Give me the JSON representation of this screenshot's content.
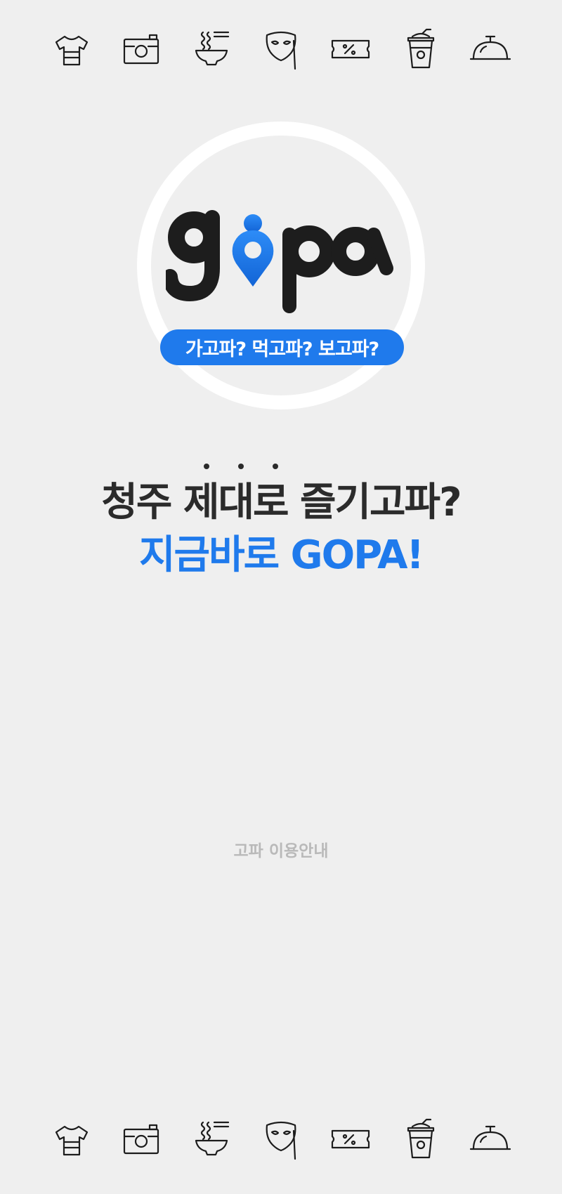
{
  "logo": {
    "wordmark": "gopa",
    "tagline": "가고파? 먹고파? 보고파?",
    "brand_color": "#1f7aec"
  },
  "headline": {
    "line1": "청주 제대로 즐기고파?",
    "line2": "지금바로 GOPA!"
  },
  "footer": {
    "guide_link": "고파 이용안내"
  },
  "icons": [
    "tshirt-icon",
    "camera-icon",
    "noodle-bowl-icon",
    "mask-icon",
    "discount-ticket-icon",
    "coffee-cup-icon",
    "food-cloche-icon"
  ]
}
